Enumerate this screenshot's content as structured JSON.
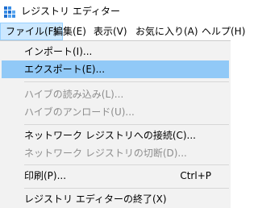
{
  "window": {
    "title": "レジストリ エディター",
    "icon": "registry-editor-icon"
  },
  "menubar": {
    "items": [
      {
        "label": "ファイル(F)",
        "active": true
      },
      {
        "label": "編集(E)"
      },
      {
        "label": "表示(V)"
      },
      {
        "label": "お気に入り(A)"
      },
      {
        "label": "ヘルプ(H)"
      }
    ]
  },
  "file_menu": {
    "items": [
      {
        "label": "インポート(I)...",
        "enabled": true
      },
      {
        "label": "エクスポート(E)...",
        "enabled": true,
        "highlighted": true
      },
      {
        "label": "ハイブの読み込み(L)...",
        "enabled": false
      },
      {
        "label": "ハイブのアンロード(U)...",
        "enabled": false
      },
      {
        "label": "ネットワーク レジストリへの接続(C)...",
        "enabled": true
      },
      {
        "label": "ネットワーク レジストリの切断(D)...",
        "enabled": false
      },
      {
        "label": "印刷(P)...",
        "enabled": true,
        "shortcut": "Ctrl+P"
      },
      {
        "label": "レジストリ エディターの終了(X)",
        "enabled": true
      }
    ]
  },
  "colors": {
    "highlight": "#91c9f7",
    "menu_background": "#f2f2f2",
    "disabled_text": "#8d8d8d"
  }
}
